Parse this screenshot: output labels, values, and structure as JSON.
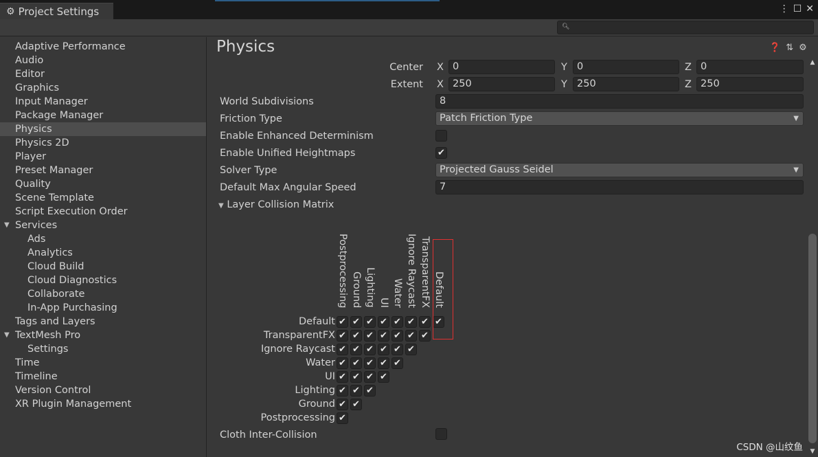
{
  "window": {
    "title": "Project Settings",
    "icon": "gear-icon"
  },
  "search": {
    "placeholder": "",
    "icon": "search-icon"
  },
  "sidebar": {
    "items": [
      {
        "label": "Adaptive Performance",
        "level": 0
      },
      {
        "label": "Audio",
        "level": 0
      },
      {
        "label": "Editor",
        "level": 0
      },
      {
        "label": "Graphics",
        "level": 0
      },
      {
        "label": "Input Manager",
        "level": 0
      },
      {
        "label": "Package Manager",
        "level": 0
      },
      {
        "label": "Physics",
        "level": 0,
        "selected": true
      },
      {
        "label": "Physics 2D",
        "level": 0
      },
      {
        "label": "Player",
        "level": 0
      },
      {
        "label": "Preset Manager",
        "level": 0
      },
      {
        "label": "Quality",
        "level": 0
      },
      {
        "label": "Scene Template",
        "level": 0
      },
      {
        "label": "Script Execution Order",
        "level": 0
      },
      {
        "label": "Services",
        "level": 0,
        "expanded": true
      },
      {
        "label": "Ads",
        "level": 1
      },
      {
        "label": "Analytics",
        "level": 1
      },
      {
        "label": "Cloud Build",
        "level": 1
      },
      {
        "label": "Cloud Diagnostics",
        "level": 1
      },
      {
        "label": "Collaborate",
        "level": 1
      },
      {
        "label": "In-App Purchasing",
        "level": 1
      },
      {
        "label": "Tags and Layers",
        "level": 0
      },
      {
        "label": "TextMesh Pro",
        "level": 0,
        "expanded": true
      },
      {
        "label": "Settings",
        "level": 1
      },
      {
        "label": "Time",
        "level": 0
      },
      {
        "label": "Timeline",
        "level": 0
      },
      {
        "label": "Version Control",
        "level": 0
      },
      {
        "label": "XR Plugin Management",
        "level": 0
      }
    ]
  },
  "main": {
    "title": "Physics",
    "center": {
      "label": "Center",
      "x": "0",
      "y": "0",
      "z": "0"
    },
    "extent": {
      "label": "Extent",
      "x": "250",
      "y": "250",
      "z": "250"
    },
    "axes": {
      "x": "X",
      "y": "Y",
      "z": "Z"
    },
    "world_subdivisions": {
      "label": "World Subdivisions",
      "value": "8"
    },
    "friction_type": {
      "label": "Friction Type",
      "value": "Patch Friction Type"
    },
    "enhanced_determinism": {
      "label": "Enable Enhanced Determinism",
      "checked": false
    },
    "unified_heightmaps": {
      "label": "Enable Unified Heightmaps",
      "checked": true
    },
    "solver_type": {
      "label": "Solver Type",
      "value": "Projected Gauss Seidel"
    },
    "max_angular_speed": {
      "label": "Default Max Angular Speed",
      "value": "7"
    },
    "matrix": {
      "label": "Layer Collision Matrix",
      "expanded": true,
      "layers": [
        "Default",
        "TransparentFX",
        "Ignore Raycast",
        "Water",
        "UI",
        "Lighting",
        "Ground",
        "Postprocessing"
      ],
      "all_checked": true,
      "highlighted_column": "Default",
      "highlight_color": "#e03030"
    },
    "cloth_inter_collision": {
      "label": "Cloth Inter-Collision",
      "checked": false
    }
  },
  "watermark": "CSDN @山纹鱼"
}
